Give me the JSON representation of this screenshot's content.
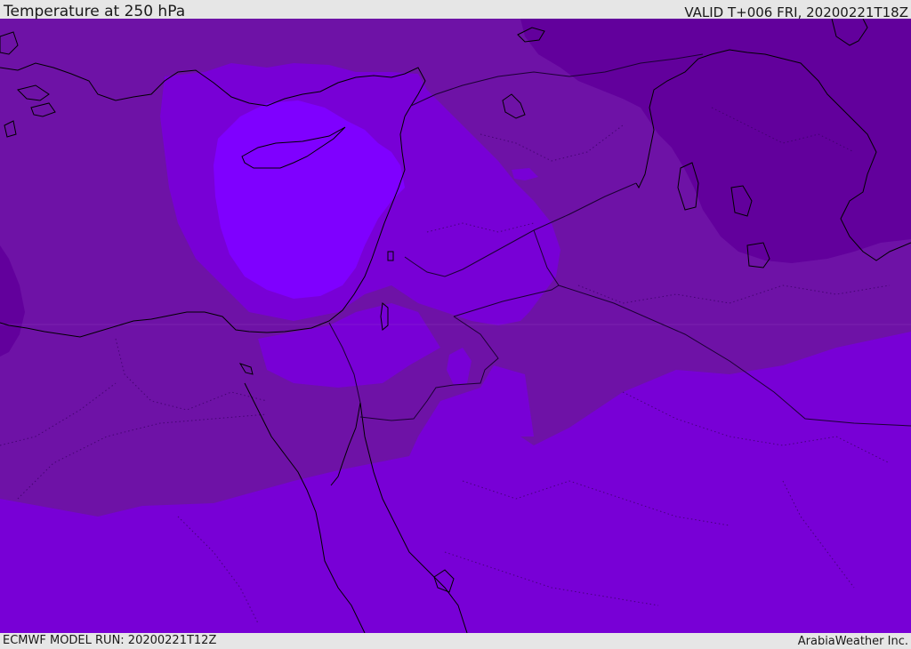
{
  "header": {
    "title": "Temperature at 250 hPa",
    "valid": "VALID T+006 FRI, 20200221T18Z"
  },
  "footer": {
    "model_run": "ECMWF MODEL RUN: 20200221T12Z",
    "credit": "ArabiaWeather Inc."
  },
  "map": {
    "region": "Eastern Mediterranean and Middle East",
    "palette": {
      "coldest": "#62009c",
      "cold": "#6e12a6",
      "mid": "#7800d6",
      "warm": "#7d00e4",
      "warmest": "#7f00ff",
      "coastline": "#000000",
      "border": "#1b0033"
    }
  }
}
